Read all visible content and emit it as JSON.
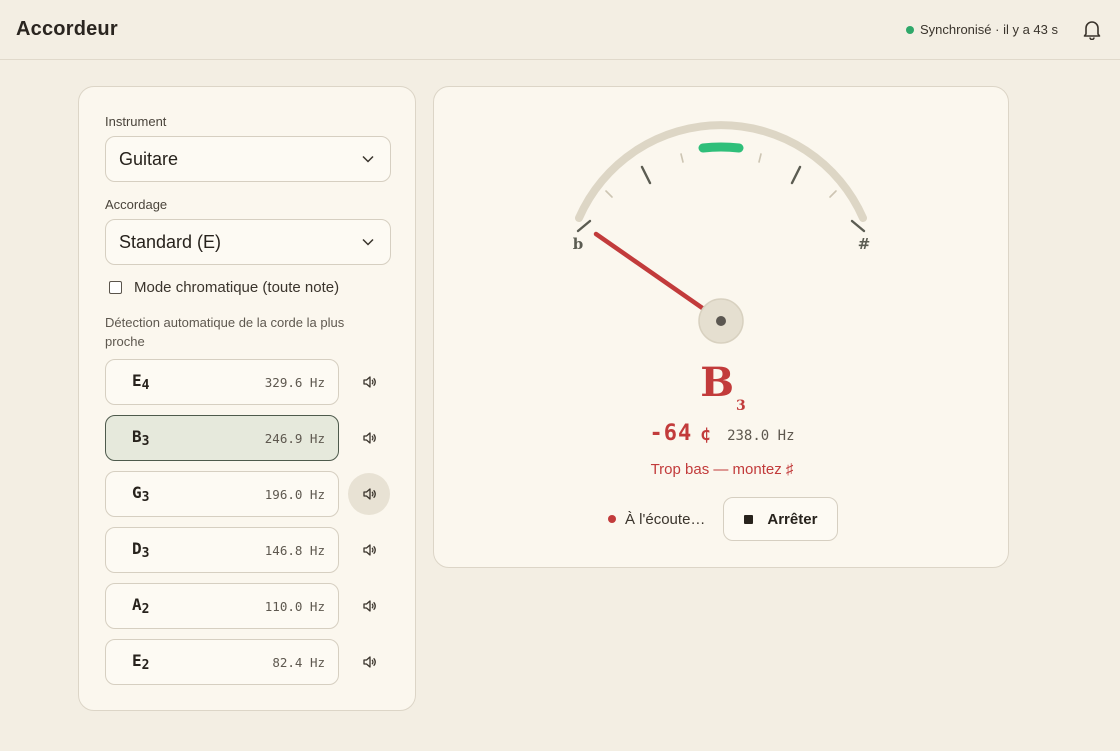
{
  "app": {
    "title": "Accordeur"
  },
  "header": {
    "sync_status": "Synchronisé · il y a 43 s",
    "sync_color": "#2fa86a",
    "bell_icon": "bell-icon"
  },
  "settings": {
    "instrument_label": "Instrument",
    "instrument_value": "Guitare",
    "tuning_label": "Accordage",
    "tuning_value": "Standard (E)",
    "chromatic_label": "Mode chromatique (toute note)",
    "chromatic_checked": false,
    "auto_detect_text": "Détection automatique de la corde la plus proche"
  },
  "strings": [
    {
      "note": "E",
      "octave": "4",
      "freq": "329.6 Hz",
      "active": false
    },
    {
      "note": "B",
      "octave": "3",
      "freq": "246.9 Hz",
      "active": true
    },
    {
      "note": "G",
      "octave": "3",
      "freq": "196.0 Hz",
      "active": false
    },
    {
      "note": "D",
      "octave": "3",
      "freq": "146.8 Hz",
      "active": false
    },
    {
      "note": "A",
      "octave": "2",
      "freq": "110.0 Hz",
      "active": false
    },
    {
      "note": "E",
      "octave": "2",
      "freq": "82.4 Hz",
      "active": false
    }
  ],
  "tuner": {
    "flat_symbol": "b",
    "sharp_symbol": "#",
    "detected_note": "B",
    "detected_octave": "3",
    "cents": "-64",
    "cents_symbol": "¢",
    "cents_value": -64,
    "frequency": "238.0 Hz",
    "hint": "Trop bas — montez ♯",
    "listening": "À l'écoute…",
    "stop_label": "Arrêter",
    "accent_red": "#c23b3b",
    "accent_green": "#2fbf7a"
  }
}
